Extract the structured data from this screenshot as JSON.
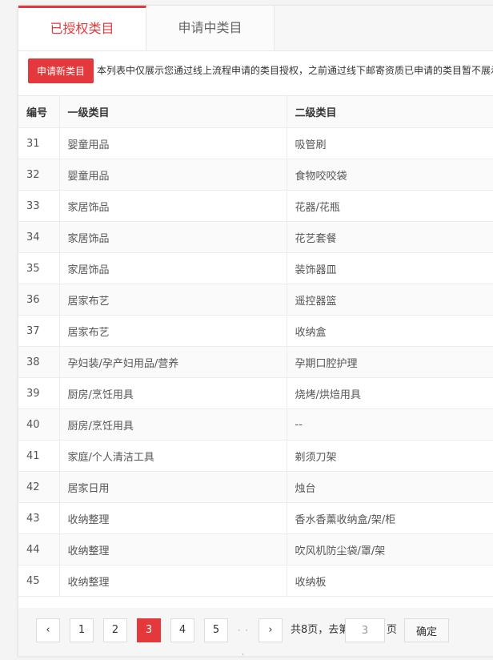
{
  "tabs": {
    "authorized": "已授权类目",
    "pending": "申请中类目"
  },
  "notice": {
    "apply_button": "申请新类目",
    "text": "本列表中仅展示您通过线上流程申请的类目授权，之前通过线下邮寄资质已申请的类目暂不展示"
  },
  "table": {
    "headers": [
      "编号",
      "一级类目",
      "二级类目"
    ],
    "rows": [
      [
        "31",
        "婴童用品",
        "吸管刷"
      ],
      [
        "32",
        "婴童用品",
        "食物咬咬袋"
      ],
      [
        "33",
        "家居饰品",
        "花器/花瓶"
      ],
      [
        "34",
        "家居饰品",
        "花艺套餐"
      ],
      [
        "35",
        "家居饰品",
        "装饰器皿"
      ],
      [
        "36",
        "居家布艺",
        "遥控器篮"
      ],
      [
        "37",
        "居家布艺",
        "收纳盒"
      ],
      [
        "38",
        "孕妇装/孕产妇用品/营养",
        "孕期口腔护理"
      ],
      [
        "39",
        "厨房/烹饪用具",
        "烧烤/烘焙用具"
      ],
      [
        "40",
        "厨房/烹饪用具",
        "--"
      ],
      [
        "41",
        "家庭/个人清洁工具",
        "剃须刀架"
      ],
      [
        "42",
        "居家日用",
        "烛台"
      ],
      [
        "43",
        "收纳整理",
        "香水香薰收纳盒/架/柜"
      ],
      [
        "44",
        "收纳整理",
        "吹风机防尘袋/罩/架"
      ],
      [
        "45",
        "收纳整理",
        "收纳板"
      ]
    ]
  },
  "pager": {
    "prev": "‹",
    "pages": [
      "1",
      "2",
      "3",
      "4",
      "5"
    ],
    "current": "3",
    "ellipsis": "· · ·",
    "next": "›",
    "total_prefix": "共8页，去第",
    "input_value": "3",
    "total_suffix": "页",
    "confirm": "确定"
  },
  "colors": {
    "accent": "#e4393c"
  }
}
